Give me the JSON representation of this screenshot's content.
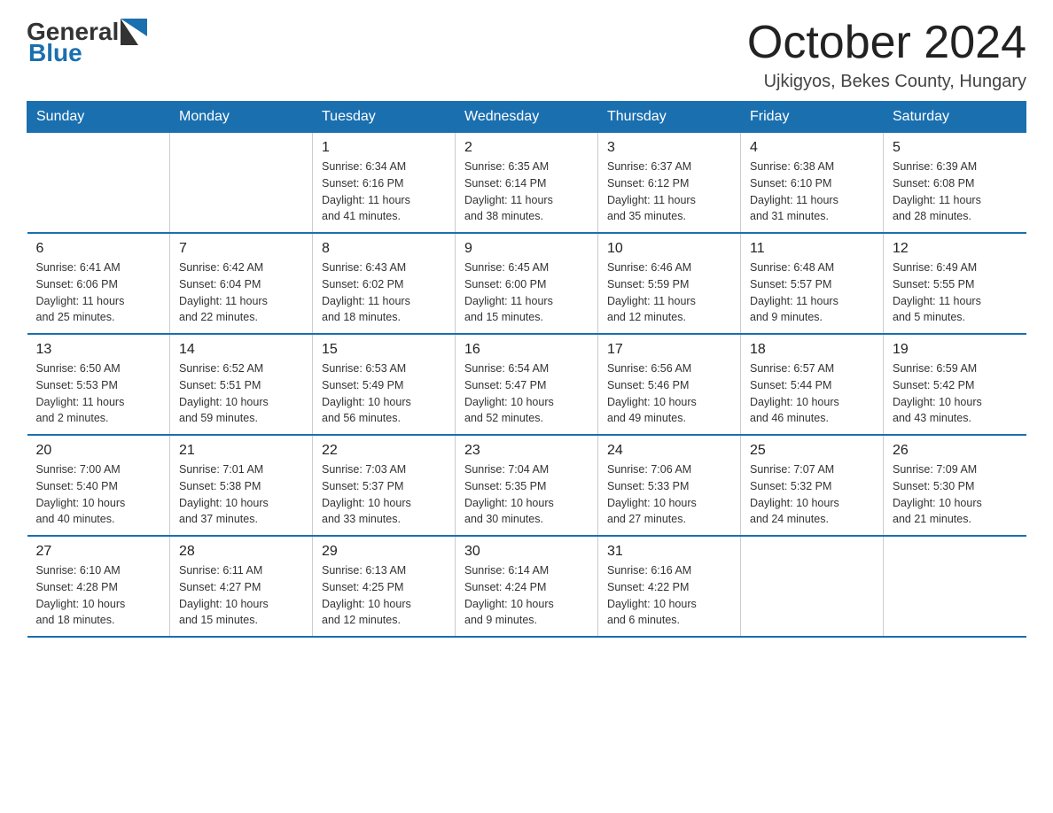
{
  "logo": {
    "general": "General",
    "blue": "Blue"
  },
  "title": "October 2024",
  "subtitle": "Ujkigyos, Bekes County, Hungary",
  "weekdays": [
    "Sunday",
    "Monday",
    "Tuesday",
    "Wednesday",
    "Thursday",
    "Friday",
    "Saturday"
  ],
  "weeks": [
    [
      {
        "day": "",
        "info": ""
      },
      {
        "day": "",
        "info": ""
      },
      {
        "day": "1",
        "info": "Sunrise: 6:34 AM\nSunset: 6:16 PM\nDaylight: 11 hours\nand 41 minutes."
      },
      {
        "day": "2",
        "info": "Sunrise: 6:35 AM\nSunset: 6:14 PM\nDaylight: 11 hours\nand 38 minutes."
      },
      {
        "day": "3",
        "info": "Sunrise: 6:37 AM\nSunset: 6:12 PM\nDaylight: 11 hours\nand 35 minutes."
      },
      {
        "day": "4",
        "info": "Sunrise: 6:38 AM\nSunset: 6:10 PM\nDaylight: 11 hours\nand 31 minutes."
      },
      {
        "day": "5",
        "info": "Sunrise: 6:39 AM\nSunset: 6:08 PM\nDaylight: 11 hours\nand 28 minutes."
      }
    ],
    [
      {
        "day": "6",
        "info": "Sunrise: 6:41 AM\nSunset: 6:06 PM\nDaylight: 11 hours\nand 25 minutes."
      },
      {
        "day": "7",
        "info": "Sunrise: 6:42 AM\nSunset: 6:04 PM\nDaylight: 11 hours\nand 22 minutes."
      },
      {
        "day": "8",
        "info": "Sunrise: 6:43 AM\nSunset: 6:02 PM\nDaylight: 11 hours\nand 18 minutes."
      },
      {
        "day": "9",
        "info": "Sunrise: 6:45 AM\nSunset: 6:00 PM\nDaylight: 11 hours\nand 15 minutes."
      },
      {
        "day": "10",
        "info": "Sunrise: 6:46 AM\nSunset: 5:59 PM\nDaylight: 11 hours\nand 12 minutes."
      },
      {
        "day": "11",
        "info": "Sunrise: 6:48 AM\nSunset: 5:57 PM\nDaylight: 11 hours\nand 9 minutes."
      },
      {
        "day": "12",
        "info": "Sunrise: 6:49 AM\nSunset: 5:55 PM\nDaylight: 11 hours\nand 5 minutes."
      }
    ],
    [
      {
        "day": "13",
        "info": "Sunrise: 6:50 AM\nSunset: 5:53 PM\nDaylight: 11 hours\nand 2 minutes."
      },
      {
        "day": "14",
        "info": "Sunrise: 6:52 AM\nSunset: 5:51 PM\nDaylight: 10 hours\nand 59 minutes."
      },
      {
        "day": "15",
        "info": "Sunrise: 6:53 AM\nSunset: 5:49 PM\nDaylight: 10 hours\nand 56 minutes."
      },
      {
        "day": "16",
        "info": "Sunrise: 6:54 AM\nSunset: 5:47 PM\nDaylight: 10 hours\nand 52 minutes."
      },
      {
        "day": "17",
        "info": "Sunrise: 6:56 AM\nSunset: 5:46 PM\nDaylight: 10 hours\nand 49 minutes."
      },
      {
        "day": "18",
        "info": "Sunrise: 6:57 AM\nSunset: 5:44 PM\nDaylight: 10 hours\nand 46 minutes."
      },
      {
        "day": "19",
        "info": "Sunrise: 6:59 AM\nSunset: 5:42 PM\nDaylight: 10 hours\nand 43 minutes."
      }
    ],
    [
      {
        "day": "20",
        "info": "Sunrise: 7:00 AM\nSunset: 5:40 PM\nDaylight: 10 hours\nand 40 minutes."
      },
      {
        "day": "21",
        "info": "Sunrise: 7:01 AM\nSunset: 5:38 PM\nDaylight: 10 hours\nand 37 minutes."
      },
      {
        "day": "22",
        "info": "Sunrise: 7:03 AM\nSunset: 5:37 PM\nDaylight: 10 hours\nand 33 minutes."
      },
      {
        "day": "23",
        "info": "Sunrise: 7:04 AM\nSunset: 5:35 PM\nDaylight: 10 hours\nand 30 minutes."
      },
      {
        "day": "24",
        "info": "Sunrise: 7:06 AM\nSunset: 5:33 PM\nDaylight: 10 hours\nand 27 minutes."
      },
      {
        "day": "25",
        "info": "Sunrise: 7:07 AM\nSunset: 5:32 PM\nDaylight: 10 hours\nand 24 minutes."
      },
      {
        "day": "26",
        "info": "Sunrise: 7:09 AM\nSunset: 5:30 PM\nDaylight: 10 hours\nand 21 minutes."
      }
    ],
    [
      {
        "day": "27",
        "info": "Sunrise: 6:10 AM\nSunset: 4:28 PM\nDaylight: 10 hours\nand 18 minutes."
      },
      {
        "day": "28",
        "info": "Sunrise: 6:11 AM\nSunset: 4:27 PM\nDaylight: 10 hours\nand 15 minutes."
      },
      {
        "day": "29",
        "info": "Sunrise: 6:13 AM\nSunset: 4:25 PM\nDaylight: 10 hours\nand 12 minutes."
      },
      {
        "day": "30",
        "info": "Sunrise: 6:14 AM\nSunset: 4:24 PM\nDaylight: 10 hours\nand 9 minutes."
      },
      {
        "day": "31",
        "info": "Sunrise: 6:16 AM\nSunset: 4:22 PM\nDaylight: 10 hours\nand 6 minutes."
      },
      {
        "day": "",
        "info": ""
      },
      {
        "day": "",
        "info": ""
      }
    ]
  ]
}
